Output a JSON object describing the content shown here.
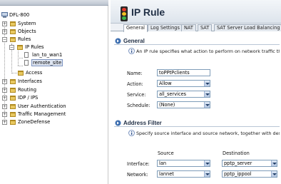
{
  "tree": {
    "root": "DFL-800",
    "items": [
      {
        "label": "System"
      },
      {
        "label": "Objects"
      },
      {
        "label": "Rules"
      },
      {
        "label": "IP Rules"
      },
      {
        "label": "lan_to_wan1"
      },
      {
        "label": "remote_site"
      },
      {
        "label": "Access"
      },
      {
        "label": "Interfaces"
      },
      {
        "label": "Routing"
      },
      {
        "label": "IDP / IPS"
      },
      {
        "label": "User Authentication"
      },
      {
        "label": "Traffic Management"
      },
      {
        "label": "ZoneDefense"
      }
    ]
  },
  "page": {
    "title": "IP Rule"
  },
  "tabs": [
    "General",
    "Log Settings",
    "NAT",
    "SAT",
    "SAT Server Load Balancing"
  ],
  "general": {
    "title": "General",
    "description": "An IP rule specifies what action to perform on network traffic tha",
    "name_label": "Name:",
    "name_value": "toPPtPclients",
    "action_label": "Action:",
    "action_value": "Allow",
    "service_label": "Service:",
    "service_value": "all_services",
    "schedule_label": "Schedule:",
    "schedule_value": "(None)"
  },
  "address_filter": {
    "title": "Address Filter",
    "description": "Specify source interface and source network, together with desti",
    "source_header": "Source",
    "destination_header": "Destination",
    "interface_label": "Interface:",
    "interface_source": "lan",
    "interface_destination": "pptp_server",
    "network_label": "Network:",
    "network_source": "lannet",
    "network_destination": "pptp_ippool"
  },
  "colors": {
    "title": "#1f2e44",
    "field_border": "#7f9db9",
    "selected": "#dfe6f2"
  }
}
